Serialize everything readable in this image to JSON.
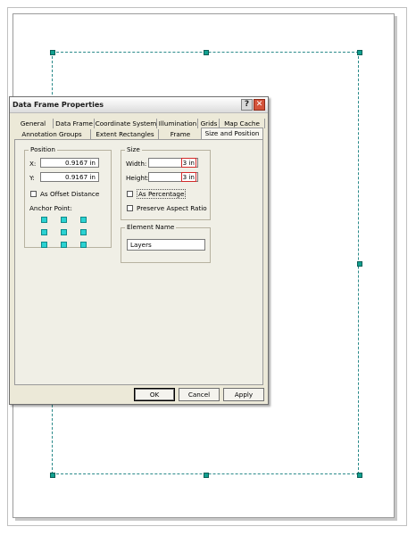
{
  "dialog": {
    "title": "Data Frame Properties",
    "help_glyph": "?",
    "close_glyph": "✕"
  },
  "tabs": {
    "top": [
      "General",
      "Data Frame",
      "Coordinate System",
      "Illumination",
      "Grids",
      "Map Cache"
    ],
    "bottom": [
      "Annotation Groups",
      "Extent Rectangles",
      "Frame",
      "Size and Position"
    ],
    "active": "Size and Position"
  },
  "position": {
    "title": "Position",
    "x_label": "X:",
    "x_value": "0.9167 in",
    "y_label": "Y:",
    "y_value": "0.9167 in",
    "offset_label": "As Offset Distance",
    "offset_checked": false,
    "anchor_label": "Anchor Point:"
  },
  "size": {
    "title": "Size",
    "width_label": "Width:",
    "width_value": "3 in",
    "height_label": "Height:",
    "height_value": "3 in",
    "percentage_label": "As Percentage",
    "percentage_checked": false,
    "aspect_label": "Preserve Aspect Ratio",
    "aspect_checked": false
  },
  "element": {
    "title": "Element Name",
    "value": "Layers"
  },
  "buttons": {
    "ok": "OK",
    "cancel": "Cancel",
    "apply": "Apply"
  },
  "colors": {
    "frame_outline": "#2a8a8a",
    "handle": "#12a090",
    "anchor": "#2bd2d2",
    "highlight_border": "#d12a2a"
  }
}
